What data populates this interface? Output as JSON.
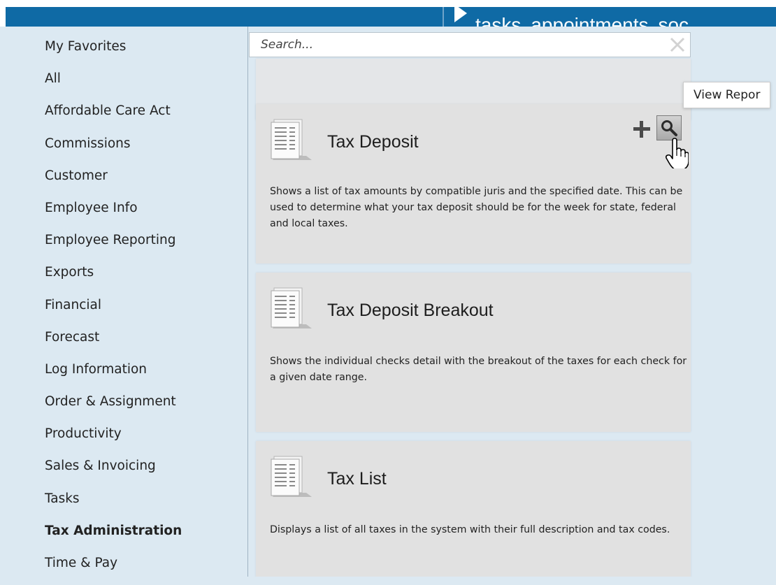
{
  "header": {
    "nav_links": [
      "tasks",
      "appointments",
      "soc"
    ],
    "nav_icon": "play-icon",
    "brand_color": "#0f6aa5"
  },
  "sidebar": {
    "items": [
      {
        "label": "My Favorites",
        "active": false
      },
      {
        "label": "All",
        "active": false
      },
      {
        "label": "Affordable Care Act",
        "active": false
      },
      {
        "label": "Commissions",
        "active": false
      },
      {
        "label": "Customer",
        "active": false
      },
      {
        "label": "Employee Info",
        "active": false
      },
      {
        "label": "Employee Reporting",
        "active": false
      },
      {
        "label": "Exports",
        "active": false
      },
      {
        "label": "Financial",
        "active": false
      },
      {
        "label": "Forecast",
        "active": false
      },
      {
        "label": "Log Information",
        "active": false
      },
      {
        "label": "Order & Assignment",
        "active": false
      },
      {
        "label": "Productivity",
        "active": false
      },
      {
        "label": "Sales & Invoicing",
        "active": false
      },
      {
        "label": "Tasks",
        "active": false
      },
      {
        "label": "Tax Administration",
        "active": true
      },
      {
        "label": "Time & Pay",
        "active": false
      }
    ]
  },
  "search": {
    "placeholder": "Search...",
    "value": "",
    "clear_icon": "close-icon"
  },
  "reports": [
    {
      "title": "Tax Deposit",
      "description": "Shows a list of tax amounts by compatible juris and the specified date.  This can be used to determine what your tax deposit should be for the week for state, federal and local taxes.",
      "icon": "report-document-icon"
    },
    {
      "title": "Tax Deposit Breakout",
      "description": "Shows the individual checks detail with the breakout of the taxes for each check for a given date range.",
      "icon": "report-document-icon"
    },
    {
      "title": "Tax List",
      "description": "Displays a list of all taxes in the system with their full description and tax codes.",
      "icon": "report-document-icon"
    }
  ],
  "card_actions": {
    "add_icon": "plus-icon",
    "view_icon": "magnifier-icon",
    "cursor_icon": "hand-pointer-icon"
  },
  "tooltip": {
    "text": "View Repor"
  }
}
